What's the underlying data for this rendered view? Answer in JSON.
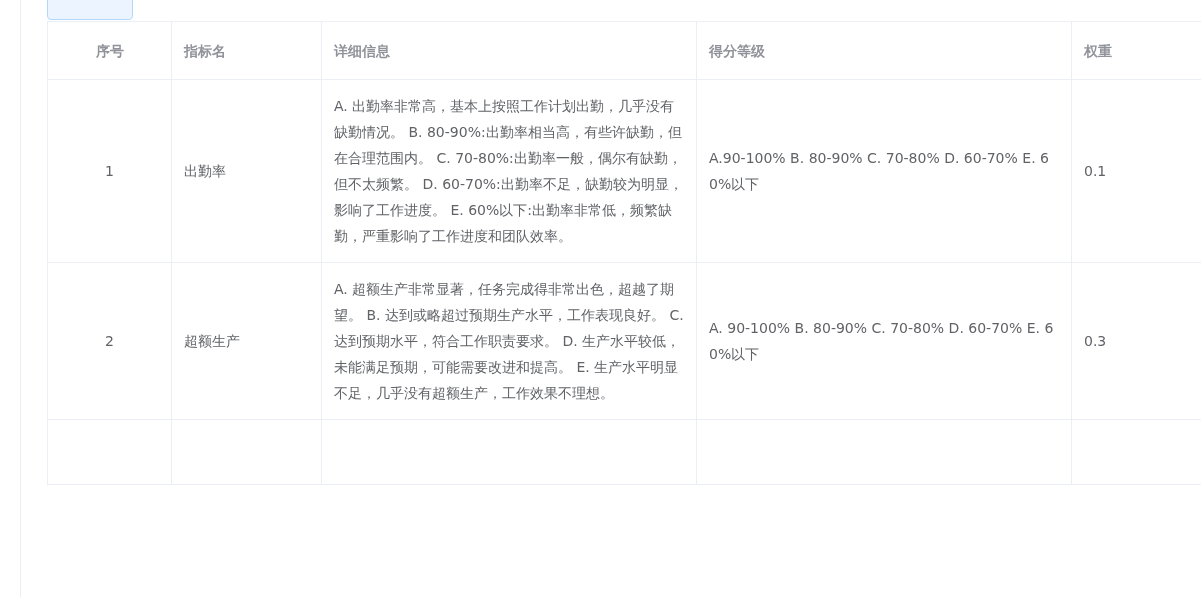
{
  "table": {
    "columns": [
      "序号",
      "指标名",
      "详细信息",
      "得分等级",
      "权重"
    ],
    "rows": [
      {
        "index": "1",
        "name": "出勤率",
        "detail": "A. 出勤率非常高，基本上按照工作计划出勤，几乎没有缺勤情况。 B. 80-90%:出勤率相当高，有些许缺勤，但在合理范围内。 C. 70-80%:出勤率一般，偶尔有缺勤，但不太频繁。 D. 60-70%:出勤率不足，缺勤较为明显，影响了工作进度。 E. 60%以下:出勤率非常低，频繁缺勤，严重影响了工作进度和团队效率。",
        "grades": "A.90-100% B. 80-90% C. 70-80% D. 60-70% E. 60%以下",
        "weight": "0.1"
      },
      {
        "index": "2",
        "name": "超额生产",
        "detail": "A. 超额生产非常显著，任务完成得非常出色，超越了期望。 B. 达到或略超过预期生产水平，工作表现良好。 C. 达到预期水平，符合工作职责要求。 D. 生产水平较低，未能满足预期，可能需要改进和提高。 E. 生产水平明显不足，几乎没有超额生产，工作效果不理想。",
        "grades": "A. 90-100% B. 80-90% C. 70-80% D. 60-70% E. 60%以下",
        "weight": "0.3"
      }
    ]
  }
}
